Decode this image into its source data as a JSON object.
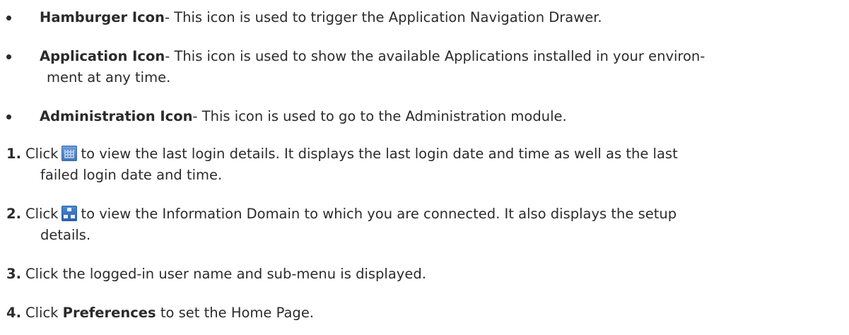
{
  "bullets": [
    {
      "title": "Hamburger Icon",
      "text": "- This icon is used to trigger the Application Navigation Drawer."
    },
    {
      "title": "Application Icon",
      "text": "- This icon is used to show the available Applications installed in your environ-",
      "continuation": "ment at any time."
    },
    {
      "title": "Administration Icon",
      "text": "- This icon is used to go to the Administration module."
    }
  ],
  "steps": [
    {
      "number": "1.",
      "prefix": "Click",
      "icon": "calendar-icon",
      "text": "to view the last login details. It displays the last login date and time as well as the last",
      "continuation": "failed login date and time."
    },
    {
      "number": "2.",
      "prefix": "Click",
      "icon": "information-domain-icon",
      "text": "to view the Information Domain to which you are connected. It also displays the setup",
      "continuation": "details."
    },
    {
      "number": "3.",
      "text": "Click the logged-in user name and sub-menu is displayed."
    },
    {
      "number": "4.",
      "prefix": "Click",
      "bold": "Preferences",
      "text": "to set the Home Page."
    }
  ]
}
